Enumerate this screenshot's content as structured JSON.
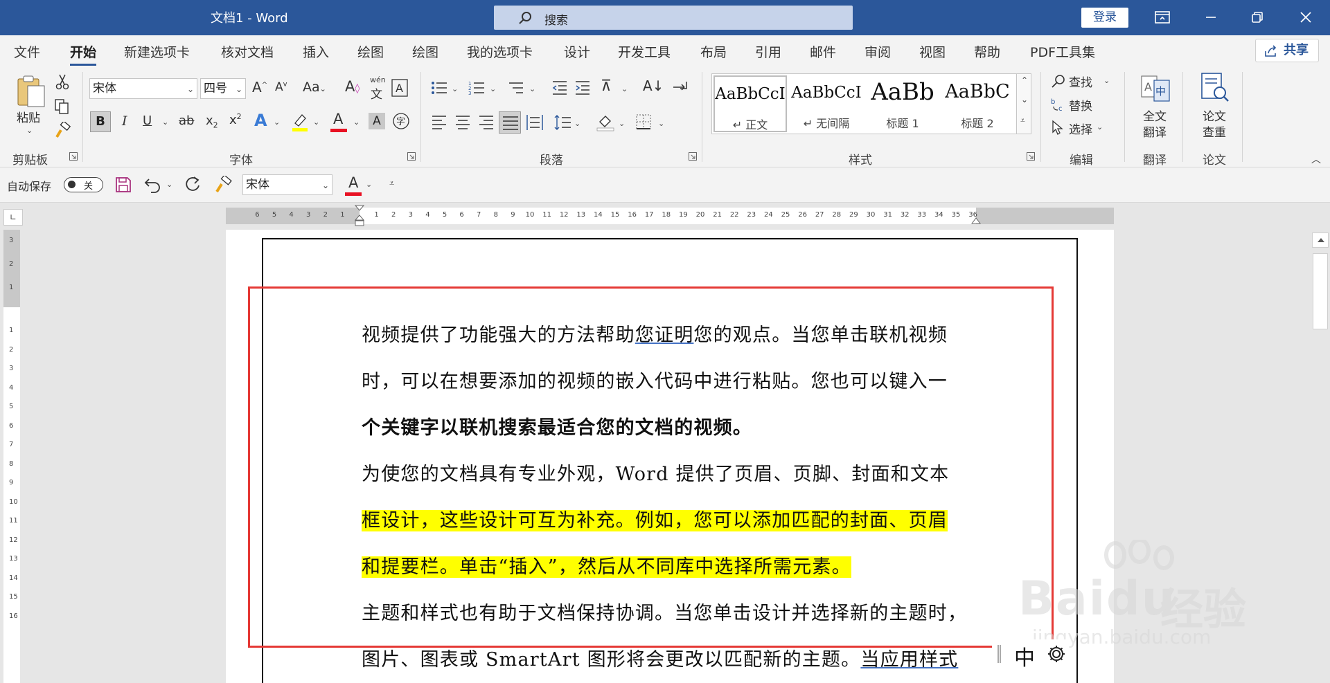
{
  "window": {
    "title": "文档1  -  Word",
    "login": "登录"
  },
  "search": {
    "placeholder": "搜索"
  },
  "menu": {
    "tabs": [
      "文件",
      "开始",
      "新建选项卡",
      "核对文档",
      "插入",
      "绘图",
      "绘图",
      "我的选项卡",
      "设计",
      "开发工具",
      "布局",
      "引用",
      "邮件",
      "审阅",
      "视图",
      "帮助",
      "PDF工具集"
    ],
    "active": "开始",
    "share": "共享"
  },
  "ribbon": {
    "clipboard": {
      "label": "剪贴板",
      "paste": "粘贴"
    },
    "font": {
      "label": "字体",
      "name": "宋体",
      "size": "四号",
      "wen_top": "wén",
      "wen_char": "文"
    },
    "paragraph": {
      "label": "段落"
    },
    "styles": {
      "label": "样式",
      "items": [
        {
          "sample": "AaBbCcI",
          "name": "↵ 正文"
        },
        {
          "sample": "AaBbCcI",
          "name": "↵ 无间隔"
        },
        {
          "sample": "AaBb",
          "name": "标题 1"
        },
        {
          "sample": "AaBbC",
          "name": "标题 2"
        }
      ]
    },
    "editing": {
      "label": "编辑",
      "find": "查找",
      "replace": "替换",
      "select": "选择"
    },
    "translate": {
      "label": "翻译",
      "button_line1": "全文",
      "button_line2": "翻译"
    },
    "thesis": {
      "label": "论文",
      "button_line1": "论文",
      "button_line2": "查重"
    }
  },
  "qat": {
    "autosave": "自动保存",
    "toggle": "关",
    "font": "宋体"
  },
  "ruler": {
    "h_left": [
      "6",
      "5",
      "4",
      "3",
      "2",
      "1"
    ],
    "h_main": [
      "1",
      "2",
      "3",
      "4",
      "5",
      "6",
      "7",
      "8",
      "9",
      "10",
      "11",
      "12",
      "13",
      "14",
      "15",
      "16",
      "17",
      "18",
      "19",
      "20",
      "21",
      "22",
      "23",
      "24",
      "25",
      "26",
      "27",
      "28",
      "29"
    ],
    "h_right": [
      "30",
      "31",
      "32",
      "33",
      "34",
      "35",
      "36"
    ],
    "v_top": [
      "3",
      "2",
      "1"
    ],
    "v_main": [
      "1",
      "2",
      "3",
      "4",
      "5",
      "6",
      "7",
      "8",
      "9",
      "10",
      "11",
      "12",
      "13",
      "14",
      "15",
      "16"
    ]
  },
  "document": {
    "lines": [
      {
        "a": "视频提供了功能强大的方法帮助",
        "u": "您证明",
        "b": "您的观点。当您单击联机视频"
      },
      {
        "text": "时，可以在想要添加的视频的嵌入代码中进行粘贴。您也可以键入一"
      },
      {
        "text": "个关键字以联机搜索最适合您的文档的视频。"
      },
      {
        "text": "为使您的文档具有专业外观，Word 提供了页眉、页脚、封面和文本"
      },
      {
        "text": "框设计，这些设计可互为补充。例如，您可以添加匹配的封面、页眉"
      },
      {
        "text": "和提要栏。单击“插入”，然后从不同库中选择所需元素。"
      },
      {
        "text": "主题和样式也有助于文档保持协调。当您单击设计并选择新的主题时，"
      },
      {
        "a": "图片、图表或 SmartArt 图形将会更改以匹配新的主题。",
        "u": "当应用样式"
      }
    ]
  },
  "ime": {
    "mode": "中"
  },
  "watermark": {
    "brand": "Baidu",
    "sub": "经验",
    "url": "jingyan.baidu.com"
  },
  "colors": {
    "titlebar": "#2b579a",
    "highlight": "#ffff00",
    "annotation": "#e53935",
    "font_red": "#e81123"
  }
}
